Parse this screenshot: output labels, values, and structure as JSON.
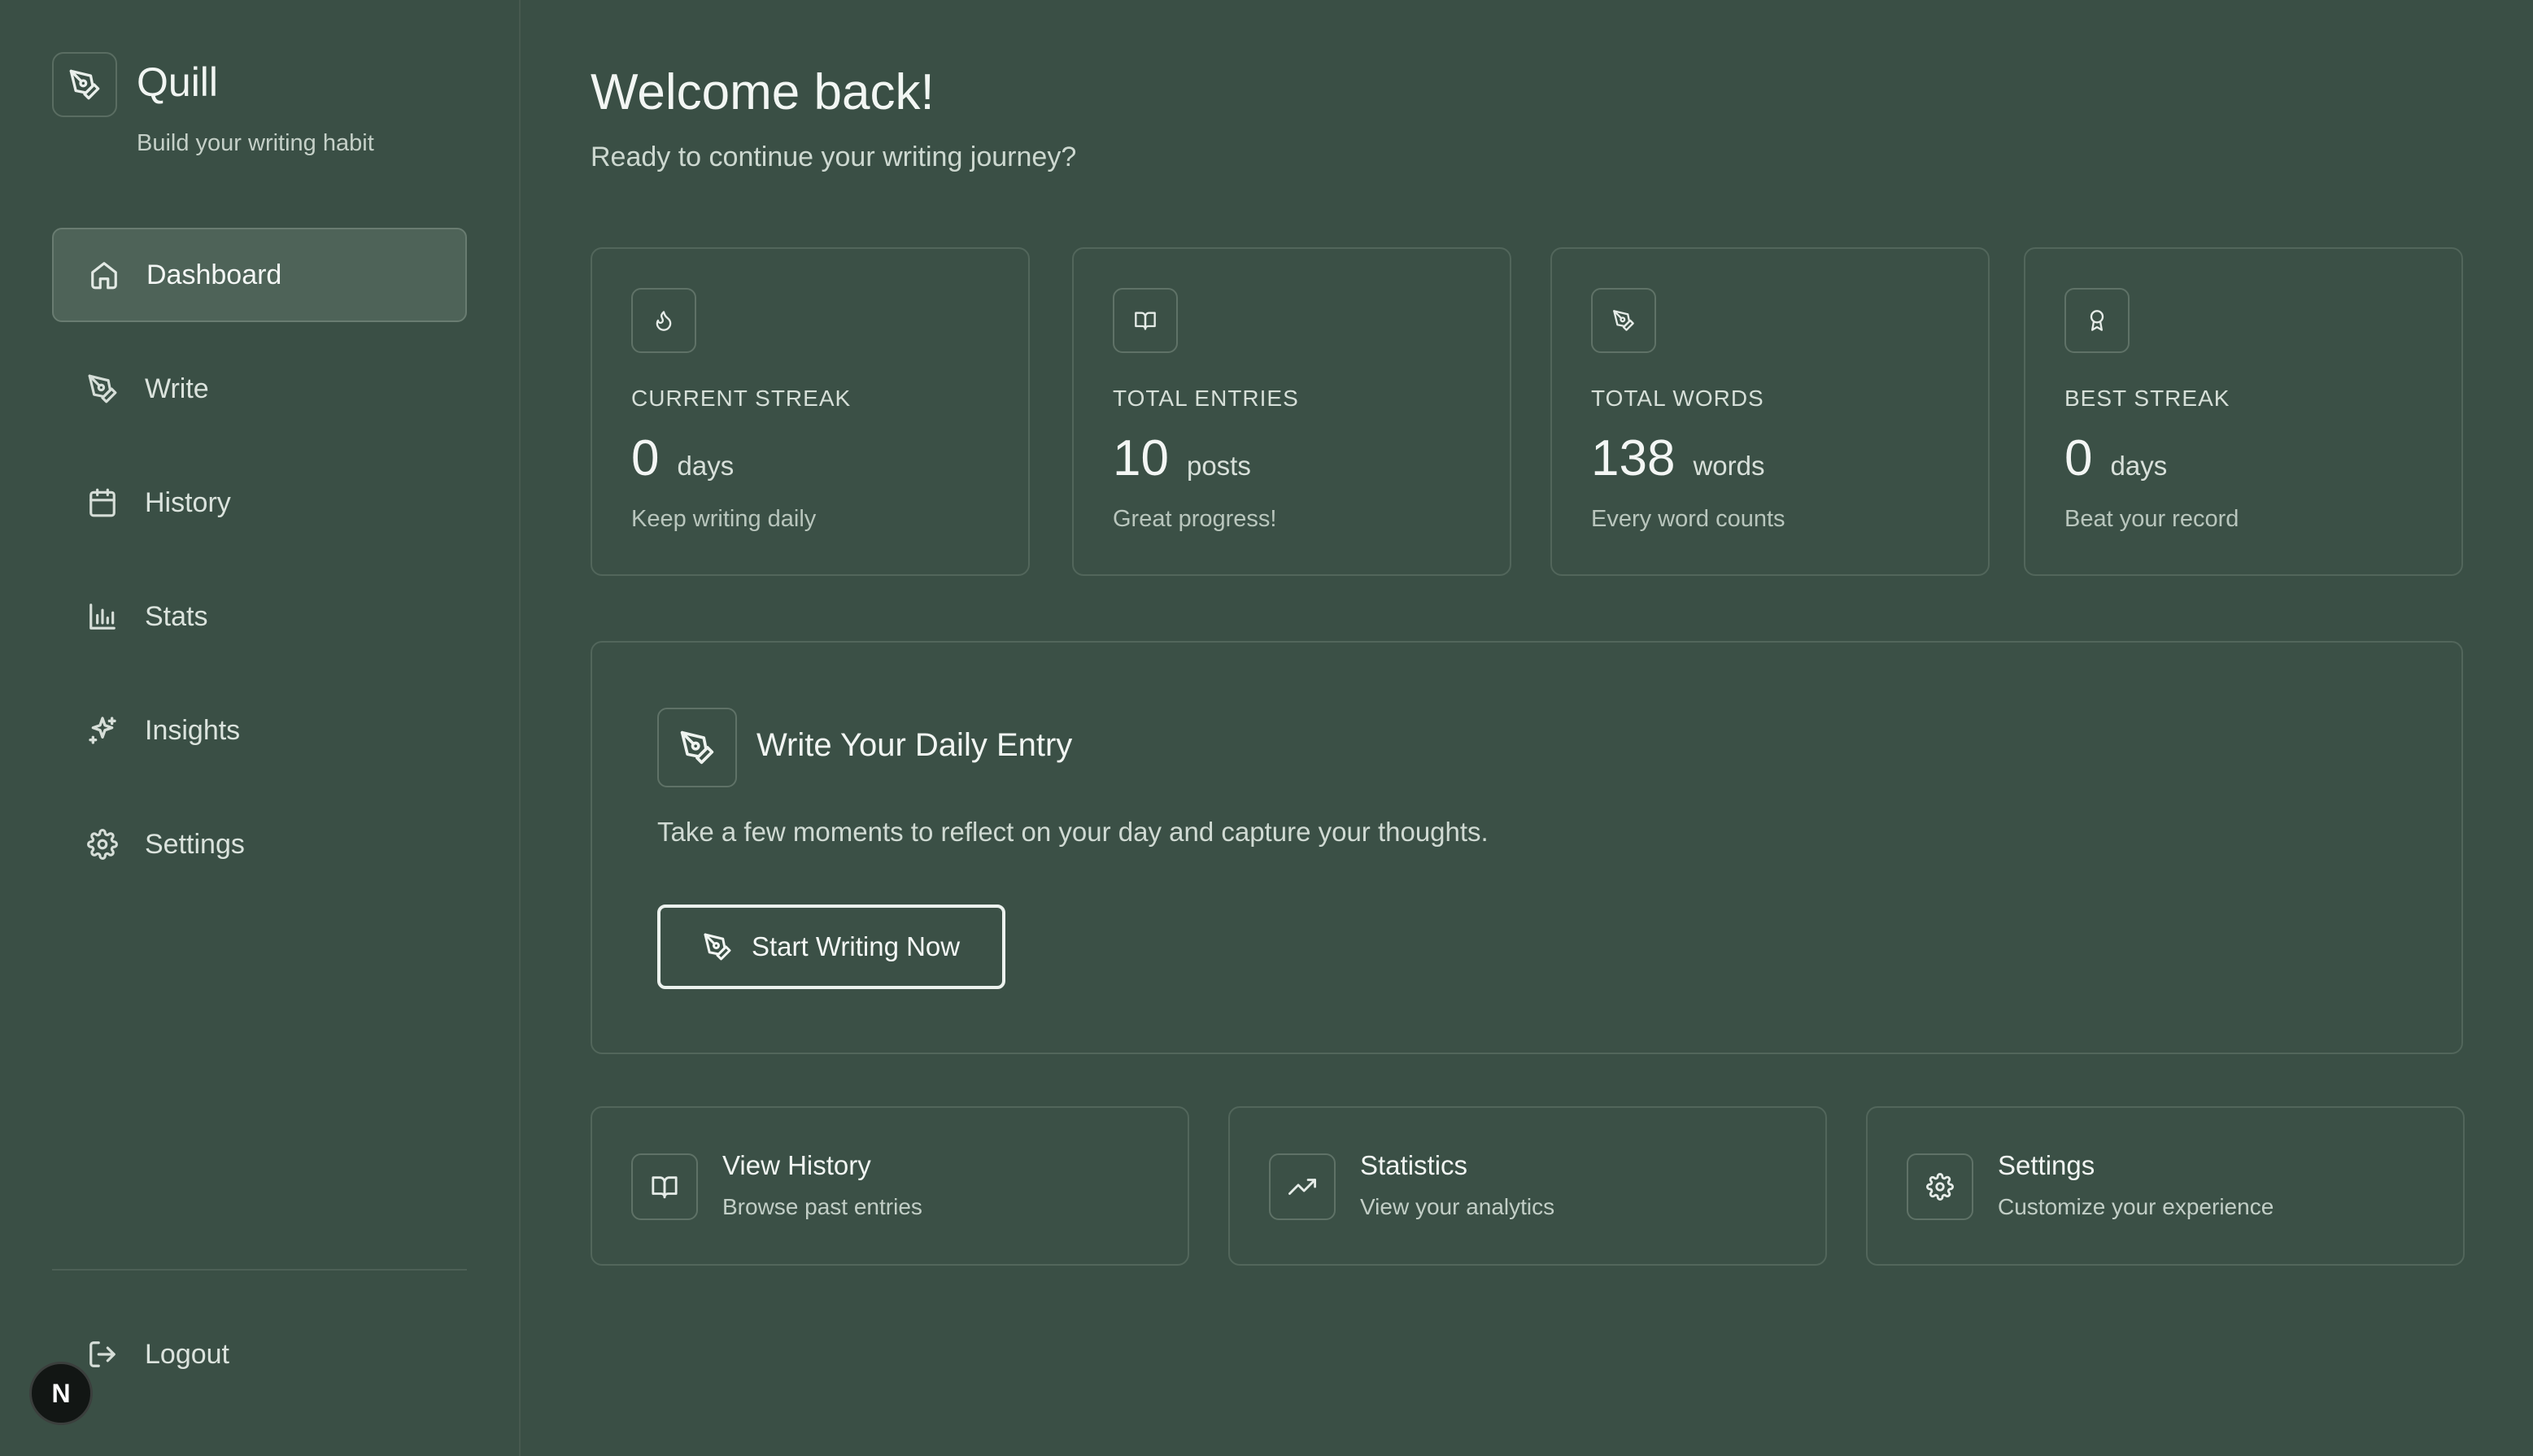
{
  "brand": {
    "name": "Quill",
    "tagline": "Build your writing habit"
  },
  "nav": [
    {
      "label": "Dashboard",
      "icon": "home-icon",
      "active": true
    },
    {
      "label": "Write",
      "icon": "pen-icon"
    },
    {
      "label": "History",
      "icon": "calendar-icon"
    },
    {
      "label": "Stats",
      "icon": "bar-chart-icon"
    },
    {
      "label": "Insights",
      "icon": "sparkles-icon"
    },
    {
      "label": "Settings",
      "icon": "gear-icon"
    }
  ],
  "logout_label": "Logout",
  "badge_letter": "N",
  "header": {
    "title": "Welcome back!",
    "subtitle": "Ready to continue your writing journey?"
  },
  "stats": [
    {
      "label": "CURRENT STREAK",
      "value": "0",
      "unit": "days",
      "hint": "Keep writing daily",
      "icon": "flame-icon"
    },
    {
      "label": "TOTAL ENTRIES",
      "value": "10",
      "unit": "posts",
      "hint": "Great progress!",
      "icon": "book-icon"
    },
    {
      "label": "TOTAL WORDS",
      "value": "138",
      "unit": "words",
      "hint": "Every word counts",
      "icon": "pen-icon"
    },
    {
      "label": "BEST STREAK",
      "value": "0",
      "unit": "days",
      "hint": "Beat your record",
      "icon": "award-icon"
    }
  ],
  "daily": {
    "title": "Write Your Daily Entry",
    "description": "Take a few moments to reflect on your day and capture your thoughts.",
    "button_label": "Start Writing Now"
  },
  "quick_links": [
    {
      "title": "View History",
      "subtitle": "Browse past entries",
      "icon": "book-icon"
    },
    {
      "title": "Statistics",
      "subtitle": "View your analytics",
      "icon": "trending-up-icon"
    },
    {
      "title": "Settings",
      "subtitle": "Customize your experience",
      "icon": "gear-icon"
    }
  ],
  "colors": {
    "background": "#3a4f45",
    "card_border": "#52665b",
    "active_nav": "#4e6358",
    "text": "#e8efe9"
  }
}
